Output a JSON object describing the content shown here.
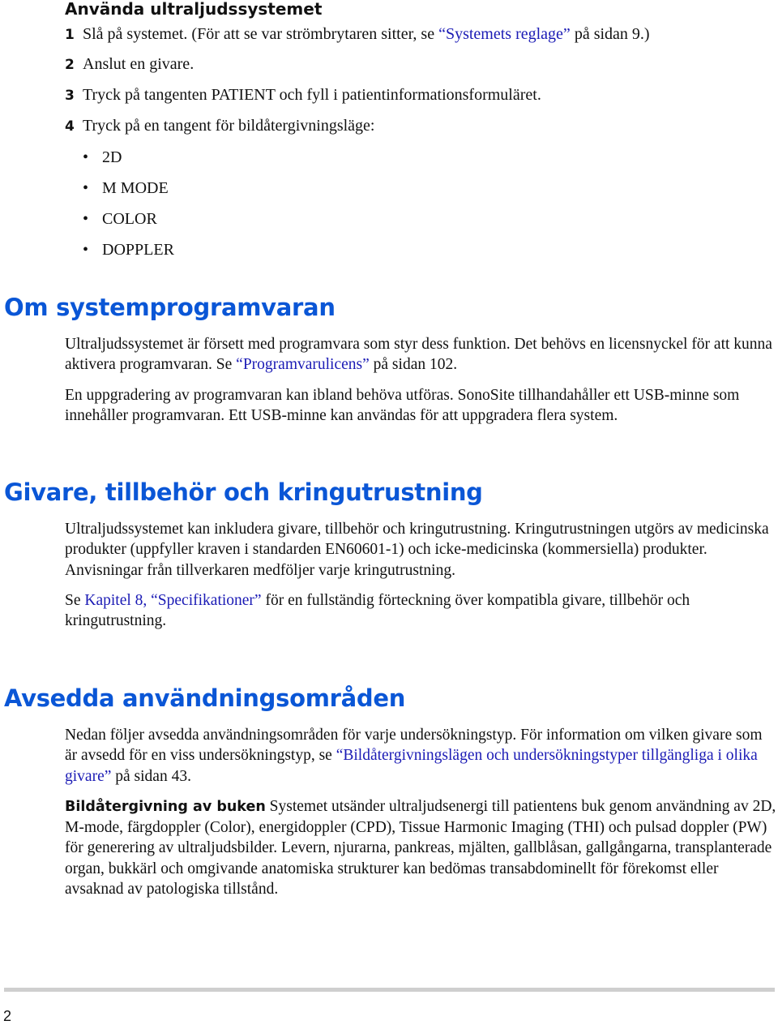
{
  "procedure": {
    "title": "Använda ultraljudssystemet",
    "steps": [
      {
        "num": "1",
        "text_before": "Slå på systemet. (För att se var strömbrytaren sitter, se ",
        "link": "“Systemets reglage”",
        "text_after": " på sidan 9.)"
      },
      {
        "num": "2",
        "text": "Anslut en givare."
      },
      {
        "num": "3",
        "text": "Tryck på tangenten PATIENT och fyll i patientinformationsformuläret."
      },
      {
        "num": "4",
        "text": "Tryck på en tangent för bildåtergivningsläge:"
      }
    ],
    "modes": [
      "2D",
      "M MODE",
      "COLOR",
      "DOPPLER"
    ],
    "bullet": "•"
  },
  "sections": {
    "software": {
      "heading": "Om systemprogramvaran",
      "p1_before": "Ultraljudssystemet är försett med programvara som styr dess funktion. Det behövs en licensnyckel för att kunna aktivera programvaran. Se ",
      "p1_link": "“Programvarulicens”",
      "p1_after": " på sidan 102.",
      "p2": "En uppgradering av programvaran kan ibland behöva utföras. SonoSite tillhandahåller ett USB-minne som innehåller programvaran. Ett USB-minne kan användas för att uppgradera flera system."
    },
    "transducers": {
      "heading": "Givare, tillbehör och kringutrustning",
      "p1": "Ultraljudssystemet kan inkludera givare, tillbehör och kringutrustning. Kringutrustningen utgörs av medicinska produkter (uppfyller kraven i standarden EN60601-1) och icke-medicinska (kommersiella) produkter. Anvisningar från tillverkaren medföljer varje kringutrustning.",
      "p2_before": "Se ",
      "p2_link": "Kapitel 8, “Specifikationer”",
      "p2_after": " för en fullständig förteckning över kompatibla givare, tillbehör och kringutrustning."
    },
    "intended_use": {
      "heading": "Avsedda användningsområden",
      "p1_before": "Nedan följer avsedda användningsområden för varje undersökningstyp. För information om vilken givare som är avsedd för en viss undersökningstyp, se ",
      "p1_link": "“Bildåtergivningslägen och undersökningstyper tillgängliga i olika givare”",
      "p1_after": " på sidan 43.",
      "p2_bold": "Bildåtergivning av buken",
      "p2_text": " Systemet utsänder ultraljudsenergi till patientens buk genom användning av 2D, M-mode, färgdoppler (Color), energidoppler (CPD), Tissue Harmonic Imaging (THI) och pulsad doppler (PW) för generering av ultraljudsbilder. Levern, njurarna, pankreas, mjälten, gallblåsan, gallgångarna, transplanterade organ, bukkärl och omgivande anatomiska strukturer kan bedömas transabdominellt för förekomst eller avsaknad av patologiska tillstånd."
    }
  },
  "footer": {
    "page_number": "2"
  },
  "colors": {
    "heading": "#0a56d6",
    "link": "#1b1bb5",
    "rule": "#cfcfcf"
  }
}
